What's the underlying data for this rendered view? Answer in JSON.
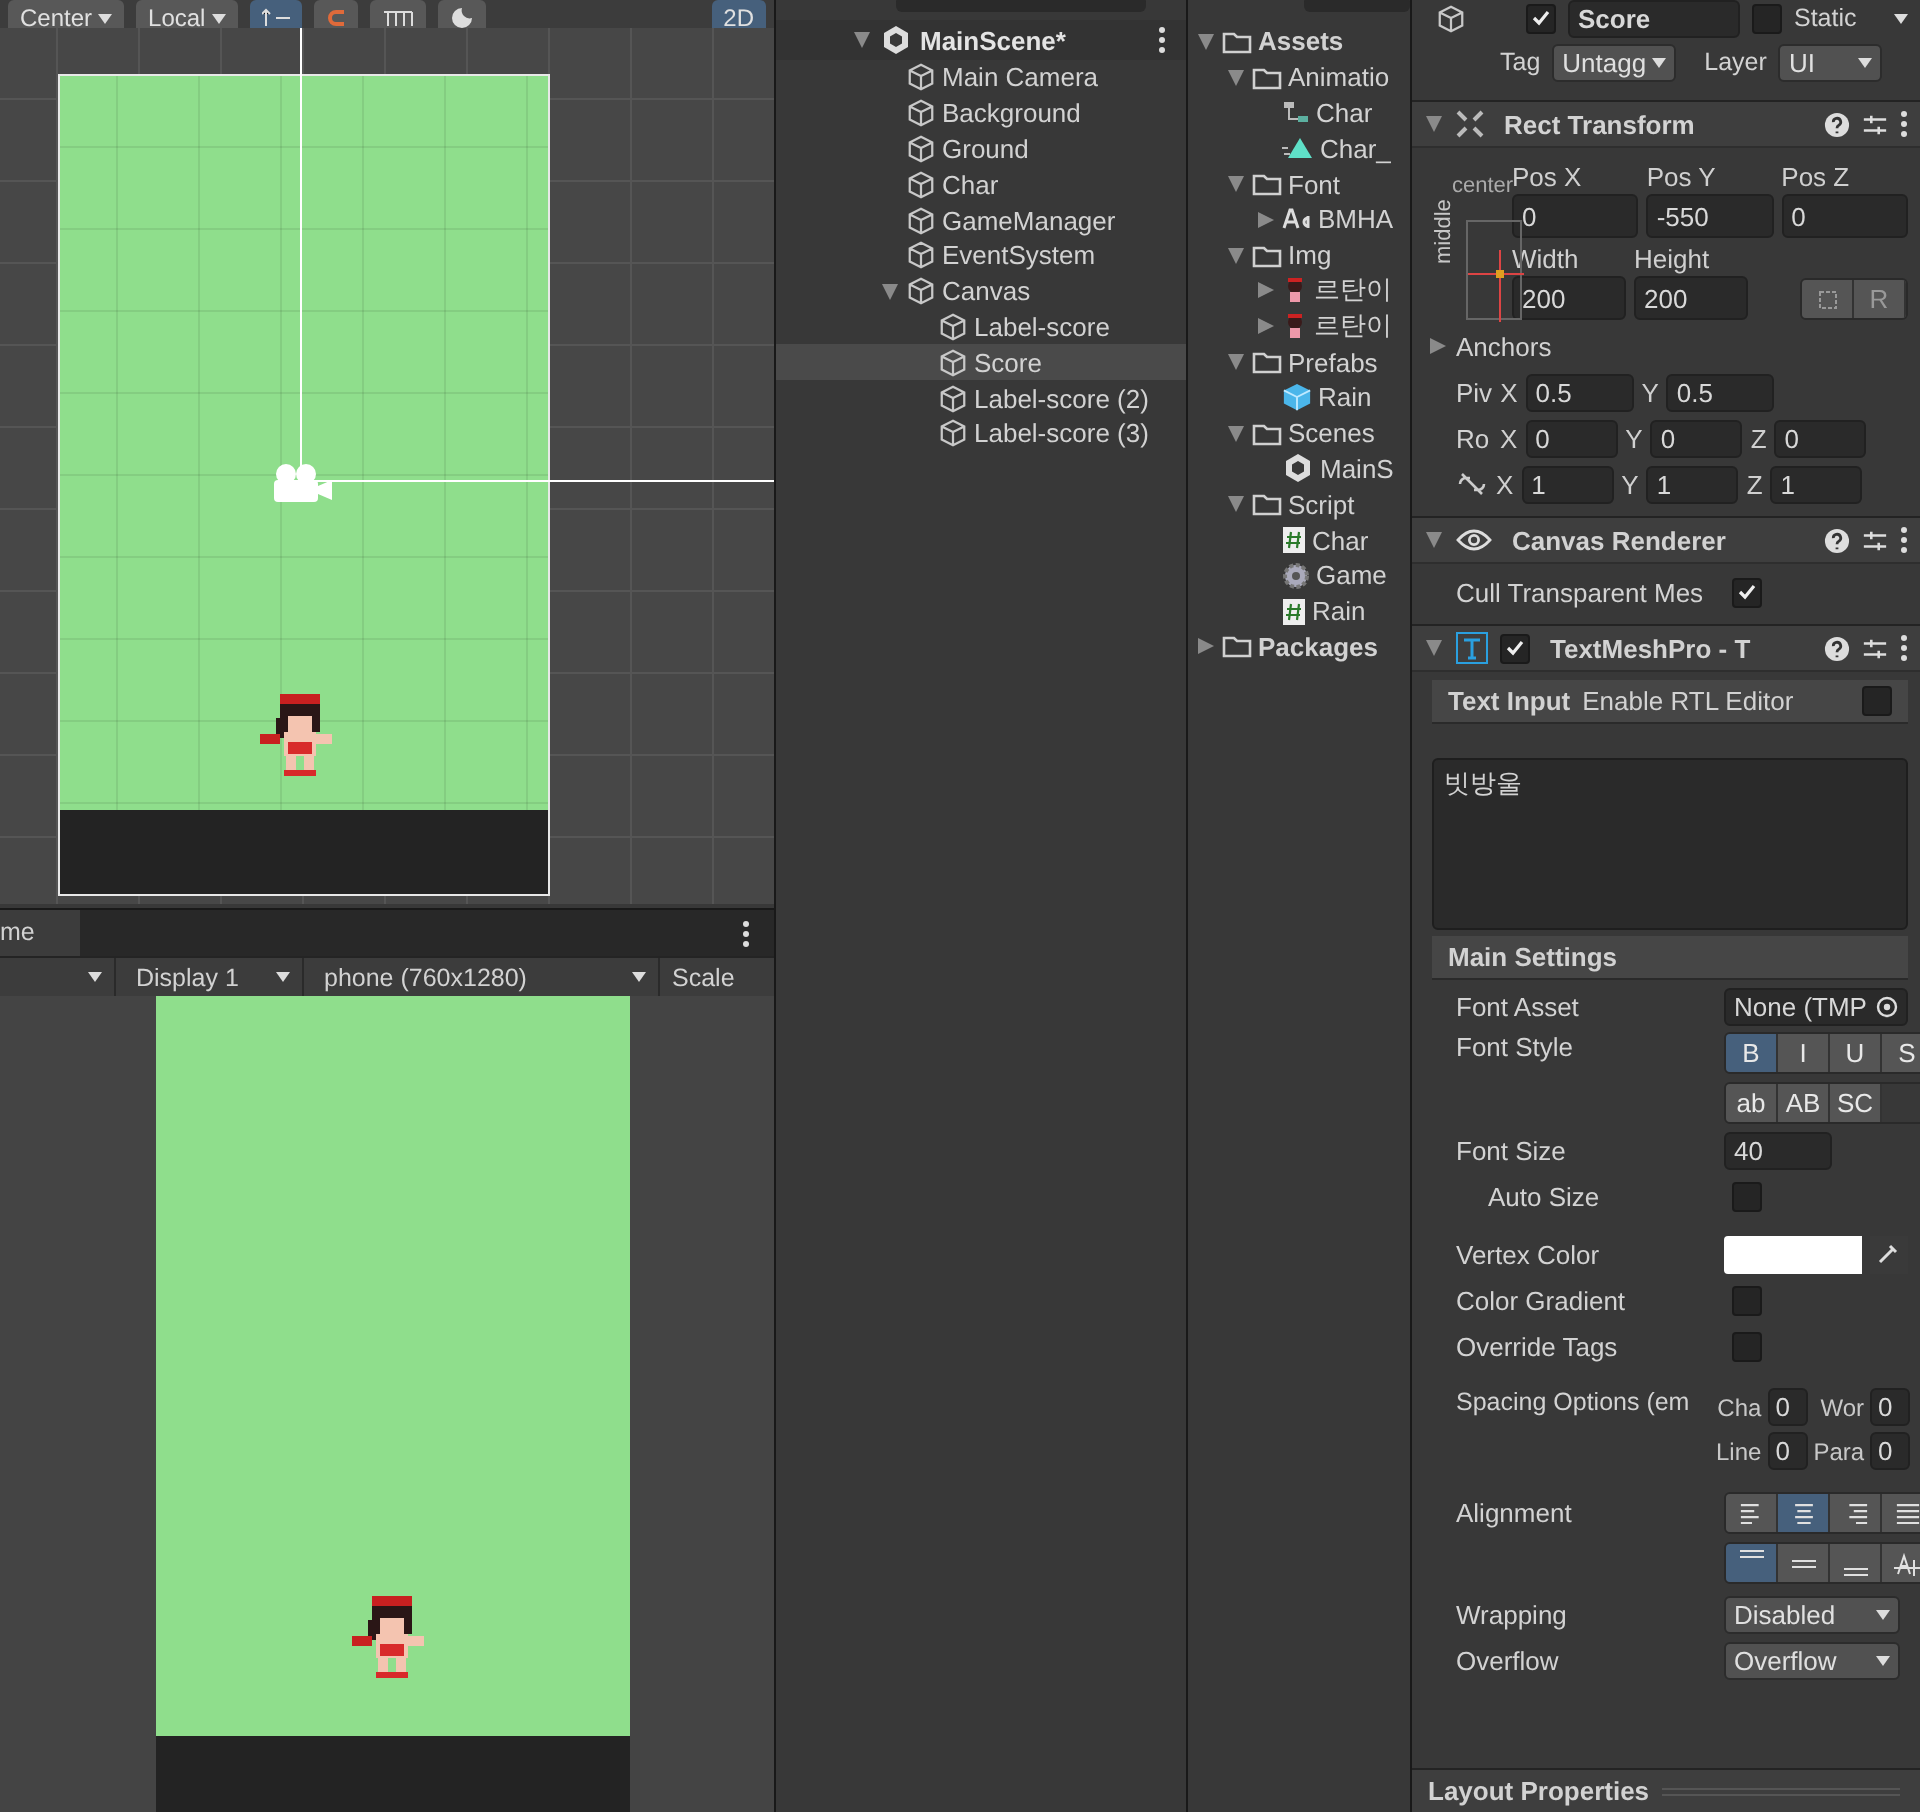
{
  "scene_view": {
    "toolbar": [
      {
        "kind": "dropdown",
        "label": "Center",
        "selected": false
      },
      {
        "kind": "dropdown",
        "label": "Local",
        "selected": false
      },
      {
        "kind": "axis",
        "selected": true
      },
      {
        "kind": "snap",
        "selected": false
      },
      {
        "kind": "ruler",
        "selected": false
      },
      {
        "kind": "light",
        "selected": false
      },
      {
        "kind": "text",
        "label": "2D",
        "selected": true
      }
    ]
  },
  "game_view": {
    "tab": "me",
    "display": "Display 1",
    "resolution": "phone (760x1280)",
    "scale": "Scale"
  },
  "hierarchy": {
    "scene": "MainScene*",
    "items": [
      {
        "label": "Main Camera",
        "selected": false
      },
      {
        "label": "Background",
        "selected": false
      },
      {
        "label": "Ground",
        "selected": false
      },
      {
        "label": "Char",
        "selected": false
      },
      {
        "label": "GameManager",
        "selected": false
      },
      {
        "label": "EventSystem",
        "selected": false
      },
      {
        "label": "Canvas",
        "selected": false,
        "expanded": true,
        "children": [
          {
            "label": "Label-score",
            "selected": false
          },
          {
            "label": "Score",
            "selected": true
          },
          {
            "label": "Label-score (2)",
            "selected": false
          },
          {
            "label": "Label-score (3)",
            "selected": false
          }
        ]
      }
    ]
  },
  "project": {
    "items": [
      {
        "kind": "folder",
        "label": "Assets",
        "expanded": true,
        "children": [
          {
            "kind": "folder",
            "label": "Animatio",
            "expanded": true,
            "children": [
              {
                "kind": "controller",
                "label": "Char"
              },
              {
                "kind": "clip",
                "label": "Char_"
              }
            ]
          },
          {
            "kind": "folder",
            "label": "Font",
            "expanded": true,
            "children": [
              {
                "kind": "font",
                "label": "BMHA",
                "expanded": false
              }
            ]
          },
          {
            "kind": "folder",
            "label": "Img",
            "expanded": true,
            "children": [
              {
                "kind": "sprite",
                "label": "르탄이",
                "expanded": false
              },
              {
                "kind": "sprite",
                "label": "르탄이",
                "expanded": false
              }
            ]
          },
          {
            "kind": "folder",
            "label": "Prefabs",
            "expanded": true,
            "children": [
              {
                "kind": "prefab",
                "label": "Rain"
              }
            ]
          },
          {
            "kind": "folder",
            "label": "Scenes",
            "expanded": true,
            "children": [
              {
                "kind": "scene",
                "label": "MainS"
              }
            ]
          },
          {
            "kind": "folder",
            "label": "Script",
            "expanded": true,
            "children": [
              {
                "kind": "script",
                "label": "Char"
              },
              {
                "kind": "gear",
                "label": "Game"
              },
              {
                "kind": "script",
                "label": "Rain"
              }
            ]
          }
        ]
      },
      {
        "kind": "folder",
        "label": "Packages",
        "expanded": false
      }
    ]
  },
  "inspector": {
    "name": "Score",
    "active": true,
    "static": false,
    "static_label": "Static",
    "tag_label": "Tag",
    "tag": "Untagg",
    "layer_label": "Layer",
    "layer": "UI",
    "components": [
      {
        "kind": "rect",
        "title": "Rect Transform",
        "expanded": true,
        "anchor_h": "center",
        "anchor_v": "middle",
        "rows": [
          {
            "kind": "labeled",
            "fields": [
              {
                "label": "Pos X",
                "value": "0"
              },
              {
                "label": "Pos Y",
                "value": "-550"
              },
              {
                "label": "Pos Z",
                "value": "0"
              }
            ]
          },
          {
            "kind": "labeled",
            "fields": [
              {
                "label": "Width",
                "value": "200"
              },
              {
                "label": "Height",
                "value": "200"
              }
            ],
            "button": "R"
          },
          {
            "kind": "foldout",
            "label": "Anchors",
            "expanded": false
          },
          {
            "kind": "xyz",
            "label": "Piv",
            "fields": [
              {
                "axis": "X",
                "value": "0.5"
              },
              {
                "axis": "Y",
                "value": "0.5"
              }
            ]
          },
          {
            "kind": "xyz",
            "label": "Ro",
            "fields": [
              {
                "axis": "X",
                "value": "0"
              },
              {
                "axis": "Y",
                "value": "0"
              },
              {
                "axis": "Z",
                "value": "0"
              }
            ]
          },
          {
            "kind": "scale",
            "fields": [
              {
                "axis": "X",
                "value": "1"
              },
              {
                "axis": "Y",
                "value": "1"
              },
              {
                "axis": "Z",
                "value": "1"
              }
            ]
          }
        ]
      },
      {
        "kind": "renderer",
        "title": "Canvas Renderer",
        "expanded": true,
        "rows": [
          {
            "kind": "toggle",
            "label": "Cull Transparent Mes",
            "checked": true
          }
        ]
      },
      {
        "kind": "text",
        "title": "TextMeshPro - T",
        "expanded": true,
        "enabled": true,
        "rows": [
          {
            "kind": "bar",
            "label": "Text Input",
            "extra": "Enable RTL Editor",
            "checked": false
          },
          {
            "kind": "textarea",
            "value": "빗방울"
          },
          {
            "kind": "bar",
            "label": "Main Settings"
          },
          {
            "kind": "object",
            "label": "Font Asset",
            "value": "None (TMP"
          },
          {
            "kind": "buttons",
            "label": "Font Style",
            "groups": [
              [
                {
                  "label": "B",
                  "selected": true
                },
                {
                  "label": "I",
                  "selected": false
                },
                {
                  "label": "U",
                  "selected": false
                },
                {
                  "label": "S",
                  "selected": false
                }
              ],
              [
                {
                  "label": "ab",
                  "selected": false
                },
                {
                  "label": "AB",
                  "selected": false
                },
                {
                  "label": "SC",
                  "selected": false
                }
              ]
            ]
          },
          {
            "kind": "number",
            "label": "Font Size",
            "value": "40"
          },
          {
            "kind": "subtoggle",
            "label": "Auto Size",
            "checked": false
          },
          {
            "kind": "color",
            "label": "Vertex Color",
            "color": "#ffffff"
          },
          {
            "kind": "toggle",
            "label": "Color Gradient",
            "checked": false
          },
          {
            "kind": "toggle",
            "label": "Override Tags",
            "checked": false
          },
          {
            "kind": "spacing",
            "label": "Spacing Options (em",
            "fields": [
              {
                "label": "Cha",
                "value": "0"
              },
              {
                "label": "Wor",
                "value": "0"
              },
              {
                "label": "Line",
                "value": "0"
              },
              {
                "label": "Para",
                "value": "0"
              }
            ]
          },
          {
            "kind": "align",
            "label": "Alignment",
            "groups": [
              [
                {
                  "selected": false
                },
                {
                  "selected": true
                },
                {
                  "selected": false
                },
                {
                  "selected": false
                }
              ],
              [
                {
                  "selected": true
                },
                {
                  "selected": false
                },
                {
                  "selected": false
                },
                {
                  "selected": false
                }
              ]
            ]
          },
          {
            "kind": "dropdown",
            "label": "Wrapping",
            "value": "Disabled"
          },
          {
            "kind": "dropdown",
            "label": "Overflow",
            "value": "Overflow"
          }
        ]
      }
    ],
    "footer": "Layout Properties"
  }
}
